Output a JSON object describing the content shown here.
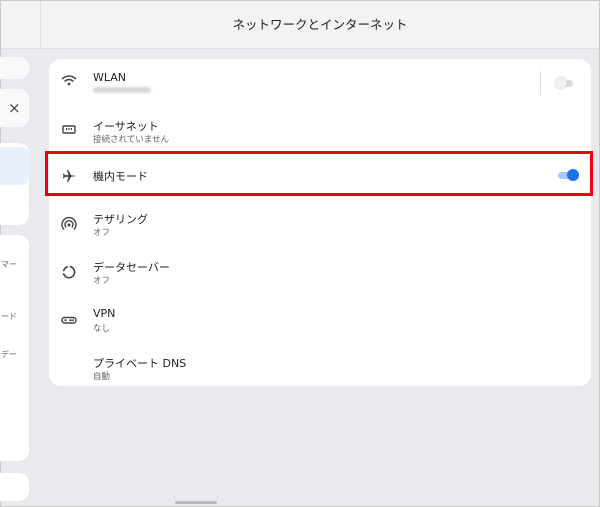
{
  "header": {
    "title": "ネットワークとインターネット"
  },
  "left_panel": {
    "close_glyph": "×",
    "fragments": [
      "マー",
      "ード",
      "デー"
    ]
  },
  "rows": [
    {
      "title": "WLAN",
      "subtitle": "",
      "icon": "wifi-icon",
      "toggle": "off",
      "subtitle_obscured": true
    },
    {
      "title": "イーサネット",
      "subtitle": "接続されていません",
      "icon": "ethernet-icon"
    },
    {
      "title": "機内モード",
      "subtitle": "",
      "icon": "airplane-icon",
      "toggle": "on"
    },
    {
      "title": "テザリング",
      "subtitle": "オフ",
      "icon": "hotspot-icon"
    },
    {
      "title": "データセーバー",
      "subtitle": "オフ",
      "icon": "data-saver-icon"
    },
    {
      "title": "VPN",
      "subtitle": "なし",
      "icon": "vpn-key-icon"
    },
    {
      "title": "プライベート DNS",
      "subtitle": "自動",
      "icon": ""
    }
  ],
  "colors": {
    "accent": "#1a73e8",
    "highlight_border": "#e60012",
    "background": "#e8eaed"
  }
}
